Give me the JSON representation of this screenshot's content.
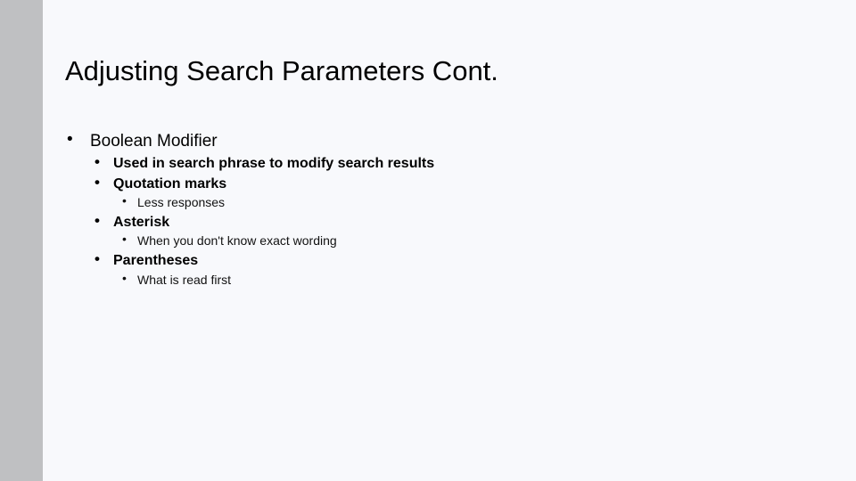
{
  "slide": {
    "title": "Adjusting Search Parameters Cont.",
    "bullet_glyph": "•",
    "items": [
      {
        "level": 1,
        "text": "Boolean Modifier"
      },
      {
        "level": 2,
        "text": "Used in search phrase to modify search results"
      },
      {
        "level": 2,
        "text": "Quotation marks"
      },
      {
        "level": 3,
        "text": "Less responses"
      },
      {
        "level": 2,
        "text": "Asterisk"
      },
      {
        "level": 3,
        "text": "When you don't know exact wording"
      },
      {
        "level": 2,
        "text": "Parentheses"
      },
      {
        "level": 3,
        "text": "What is read first"
      }
    ]
  },
  "colors": {
    "background": "#f8f9fc",
    "sidebar": "#bfc0c2",
    "text": "#000000"
  }
}
